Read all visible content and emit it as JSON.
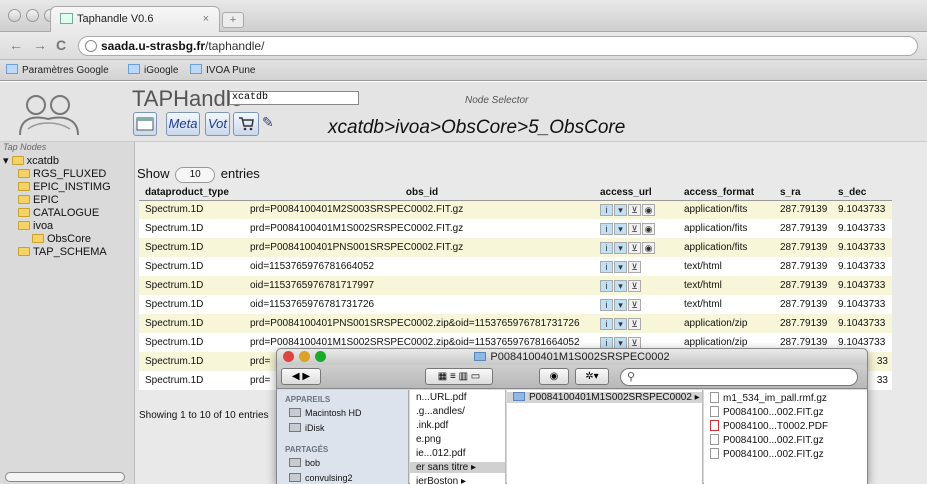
{
  "browser": {
    "tab_title": "Taphandle V0.6",
    "tab_close": "×",
    "url_host": "saada.u-strasbg.fr",
    "url_path": "/taphandle/",
    "bookmarks": [
      "Paramètres Google",
      "iGoogle",
      "IVOA Pune"
    ]
  },
  "app": {
    "title": "TAPHandle",
    "db_value": "xcatdb",
    "node_selector": "Node Selector",
    "buttons": [
      "Meta",
      "Vot"
    ],
    "breadcrumb": "xcatdb>ivoa>ObsCore>5_ObsCore"
  },
  "sidebar": {
    "title": "Tap Nodes",
    "nodes": [
      {
        "label": "xcatdb",
        "level": 0
      },
      {
        "label": "RGS_FLUXED",
        "level": 1
      },
      {
        "label": "EPIC_INSTIMG",
        "level": 1
      },
      {
        "label": "EPIC",
        "level": 1
      },
      {
        "label": "CATALOGUE",
        "level": 1
      },
      {
        "label": "ivoa",
        "level": 1
      },
      {
        "label": "ObsCore",
        "level": 2
      },
      {
        "label": "TAP_SCHEMA",
        "level": 1
      }
    ]
  },
  "table": {
    "show_label": "Show",
    "show_value": "10",
    "entries_label": "entries",
    "columns": [
      "dataproduct_type",
      "obs_id",
      "access_url",
      "access_format",
      "s_ra",
      "s_dec"
    ],
    "rows": [
      [
        "Spectrum.1D",
        "prd=P0084100401M2S003SRSPEC0002.FIT.gz",
        "application/fits",
        "287.79139",
        "9.1043733"
      ],
      [
        "Spectrum.1D",
        "prd=P0084100401M1S002SRSPEC0002.FIT.gz",
        "application/fits",
        "287.79139",
        "9.1043733"
      ],
      [
        "Spectrum.1D",
        "prd=P0084100401PNS001SRSPEC0002.FIT.gz",
        "application/fits",
        "287.79139",
        "9.1043733"
      ],
      [
        "Spectrum.1D",
        "oid=1153765976781664052",
        "text/html",
        "287.79139",
        "9.1043733"
      ],
      [
        "Spectrum.1D",
        "oid=1153765976781717997",
        "text/html",
        "287.79139",
        "9.1043733"
      ],
      [
        "Spectrum.1D",
        "oid=1153765976781731726",
        "text/html",
        "287.79139",
        "9.1043733"
      ],
      [
        "Spectrum.1D",
        "prd=P0084100401PNS001SRSPEC0002.zip&oid=1153765976781731726",
        "application/zip",
        "287.79139",
        "9.1043733"
      ],
      [
        "Spectrum.1D",
        "prd=P0084100401M1S002SRSPEC0002.zip&oid=1153765976781664052",
        "application/zip",
        "287.79139",
        "9.1043733"
      ],
      [
        "Spectrum.1D",
        "prd=",
        "",
        "",
        "33"
      ],
      [
        "Spectrum.1D",
        "prd=",
        "",
        "",
        "33"
      ]
    ],
    "info": "Showing 1 to 10 of 10 entries"
  },
  "finder": {
    "title": "P0084100401M1S002SRSPEC0002",
    "search_placeholder": "",
    "sections": [
      {
        "header": "APPAREILS",
        "items": [
          "Macintosh HD",
          "iDisk"
        ]
      },
      {
        "header": "PARTAGÉS",
        "items": [
          "bob",
          "convulsing2"
        ]
      }
    ],
    "col1": [
      "n...URL.pdf",
      ".g...andles/",
      ".ink.pdf",
      "e.png",
      "ie...012.pdf",
      "er sans titre",
      "ierBoston"
    ],
    "col2": [
      "P0084100401M1S002SRSPEC0002"
    ],
    "col3": [
      "m1_534_im_pall.rmf.gz",
      "P0084100...002.FIT.gz",
      "P0084100...T0002.PDF",
      "P0084100...002.FIT.gz",
      "P0084100...002.FIT.gz"
    ]
  }
}
